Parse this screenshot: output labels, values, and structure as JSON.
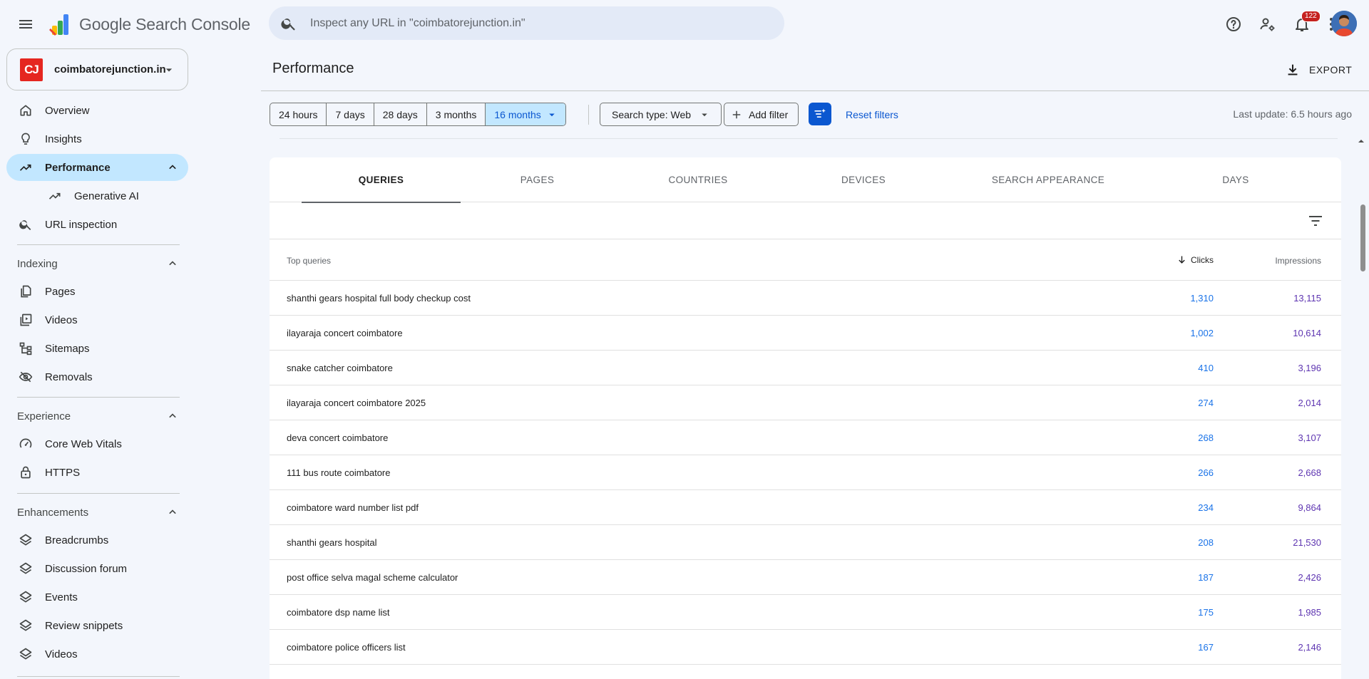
{
  "app": {
    "name": "Google Search Console"
  },
  "search": {
    "placeholder": "Inspect any URL in \"coimbatorejunction.in\""
  },
  "header": {
    "notification_count": "122"
  },
  "property": {
    "logo_text": "CJ",
    "name": "coimbatorejunction.in"
  },
  "nav": {
    "overview": "Overview",
    "insights": "Insights",
    "performance": "Performance",
    "generative_ai": "Generative AI",
    "url_inspection": "URL inspection",
    "indexing": {
      "header": "Indexing",
      "items": [
        "Pages",
        "Videos",
        "Sitemaps",
        "Removals"
      ]
    },
    "experience": {
      "header": "Experience",
      "items": [
        "Core Web Vitals",
        "HTTPS"
      ]
    },
    "enhancements": {
      "header": "Enhancements",
      "items": [
        "Breadcrumbs",
        "Discussion forum",
        "Events",
        "Review snippets",
        "Videos"
      ]
    }
  },
  "page": {
    "title": "Performance",
    "export_label": "EXPORT",
    "last_update": "Last update: 6.5 hours ago"
  },
  "filters": {
    "ranges": [
      "24 hours",
      "7 days",
      "28 days",
      "3 months",
      "16 months"
    ],
    "selected_range": "16 months",
    "search_type": "Search type: Web",
    "add_filter": "Add filter",
    "reset": "Reset filters"
  },
  "tabs": [
    "QUERIES",
    "PAGES",
    "COUNTRIES",
    "DEVICES",
    "SEARCH APPEARANCE",
    "DAYS"
  ],
  "selected_tab": "QUERIES",
  "table": {
    "headers": {
      "query": "Top queries",
      "clicks": "Clicks",
      "impressions": "Impressions"
    },
    "rows": [
      {
        "query": "shanthi gears hospital full body checkup cost",
        "clicks": "1,310",
        "impressions": "13,115"
      },
      {
        "query": "ilayaraja concert coimbatore",
        "clicks": "1,002",
        "impressions": "10,614"
      },
      {
        "query": "snake catcher coimbatore",
        "clicks": "410",
        "impressions": "3,196"
      },
      {
        "query": "ilayaraja concert coimbatore 2025",
        "clicks": "274",
        "impressions": "2,014"
      },
      {
        "query": "deva concert coimbatore",
        "clicks": "268",
        "impressions": "3,107"
      },
      {
        "query": "111 bus route coimbatore",
        "clicks": "266",
        "impressions": "2,668"
      },
      {
        "query": "coimbatore ward number list pdf",
        "clicks": "234",
        "impressions": "9,864"
      },
      {
        "query": "shanthi gears hospital",
        "clicks": "208",
        "impressions": "21,530"
      },
      {
        "query": "post office selva magal scheme calculator",
        "clicks": "187",
        "impressions": "2,426"
      },
      {
        "query": "coimbatore dsp name list",
        "clicks": "175",
        "impressions": "1,985"
      },
      {
        "query": "coimbatore police officers list",
        "clicks": "167",
        "impressions": "2,146"
      }
    ]
  },
  "colors": {
    "accent": "#0b57d0",
    "active_nav": "#c2e7ff",
    "clicks": "#1a73e8",
    "impressions": "#5e35b1"
  }
}
